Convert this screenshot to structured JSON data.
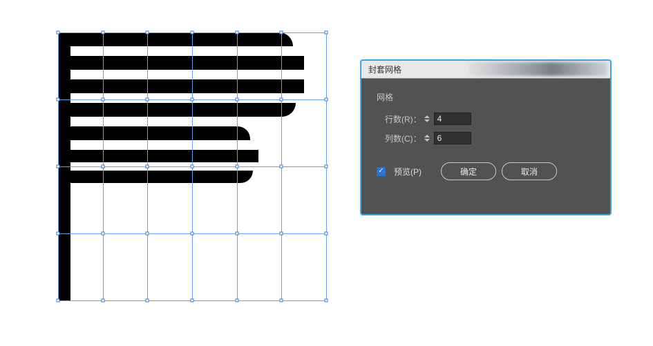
{
  "dialog": {
    "title": "封套网格",
    "group_label": "网格",
    "rows_label": "行数(R)：",
    "rows_value": "4",
    "cols_label": "列数(C)：",
    "cols_value": "6",
    "preview_label": "预览(P)",
    "preview_checked": true,
    "ok_label": "确定",
    "cancel_label": "取消"
  },
  "mesh": {
    "rows": 4,
    "cols": 6
  }
}
